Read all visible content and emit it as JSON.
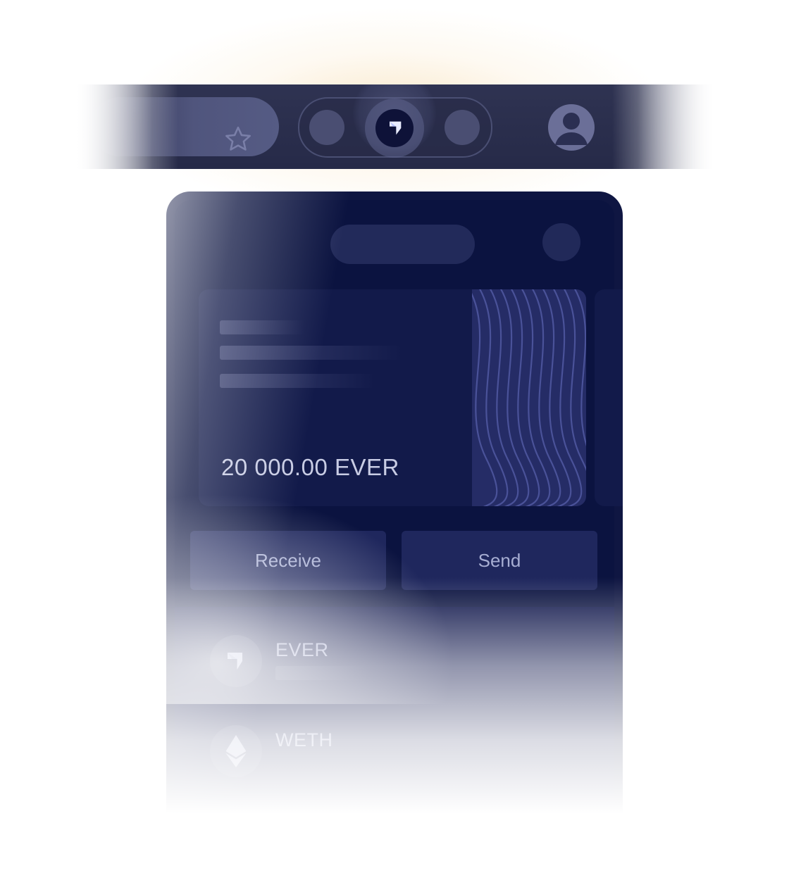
{
  "toolbar": {
    "star_icon": "star-icon",
    "extension_icon": "ever-wallet-icon",
    "profile_icon": "user-avatar-icon"
  },
  "wallet": {
    "balance": "20 000.00 EVER",
    "actions": {
      "receive_label": "Receive",
      "send_label": "Send"
    },
    "tokens": [
      {
        "name": "EVER",
        "icon": "ever-icon"
      },
      {
        "name": "WETH",
        "icon": "ethereum-icon"
      }
    ]
  },
  "colors": {
    "popup_bg": "#0b1340",
    "card_bg": "#121a4a",
    "button_bg": "#1f275d",
    "toolbar_bg": "#2a2e4c",
    "accent_glow": "#f6d6a0"
  }
}
